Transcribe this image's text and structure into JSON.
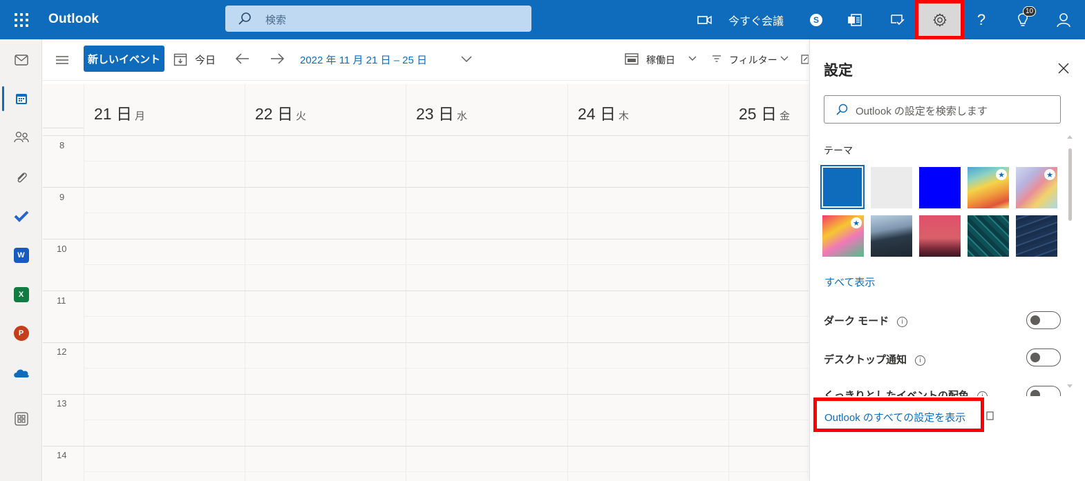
{
  "topbar": {
    "app_name": "Outlook",
    "search_placeholder": "検索",
    "meet_now_label": "今すぐ会議",
    "notification_count": "10",
    "skype_letter": "S"
  },
  "commandbar": {
    "new_event_label": "新しいイベント",
    "today_label": "今日",
    "date_range": "2022 年 11 月 21 日 – 25 日",
    "view_label": "稼働日",
    "filter_label": "フィルター"
  },
  "calendar": {
    "days": [
      {
        "num": "21 日",
        "weekday": "月"
      },
      {
        "num": "22 日",
        "weekday": "火"
      },
      {
        "num": "23 日",
        "weekday": "水"
      },
      {
        "num": "24 日",
        "weekday": "木"
      },
      {
        "num": "25 日",
        "weekday": "金"
      }
    ],
    "hours": [
      "8",
      "9",
      "10",
      "11",
      "12",
      "13",
      "14"
    ]
  },
  "rail": {
    "word_letter": "W",
    "excel_letter": "X",
    "powerpoint_letter": "P"
  },
  "settings": {
    "title": "設定",
    "search_placeholder": "Outlook の設定を検索します",
    "theme_label": "テーマ",
    "show_all_label": "すべて表示",
    "dark_mode_label": "ダーク モード",
    "desktop_notify_label": "デスクトップ通知",
    "bold_event_label": "くっきりとしたイベントの配色",
    "all_settings_link": "Outlook のすべての設定を表示",
    "themes": [
      {
        "name": "blue",
        "color": "#0f6cbd",
        "selected": true
      },
      {
        "name": "light-gray",
        "color": "#ebebeb"
      },
      {
        "name": "bright-blue",
        "color": "#0000ff"
      },
      {
        "name": "rainbow-waves",
        "premium": true
      },
      {
        "name": "pastel-lines",
        "premium": true
      },
      {
        "name": "colorful-art",
        "premium": true
      },
      {
        "name": "mountains"
      },
      {
        "name": "palm-sunset"
      },
      {
        "name": "circuit"
      },
      {
        "name": "stamp"
      }
    ],
    "info_glyph": "i",
    "star_glyph": "★"
  },
  "colors": {
    "brand": "#0f6cbd",
    "highlight": "#ff0000"
  }
}
